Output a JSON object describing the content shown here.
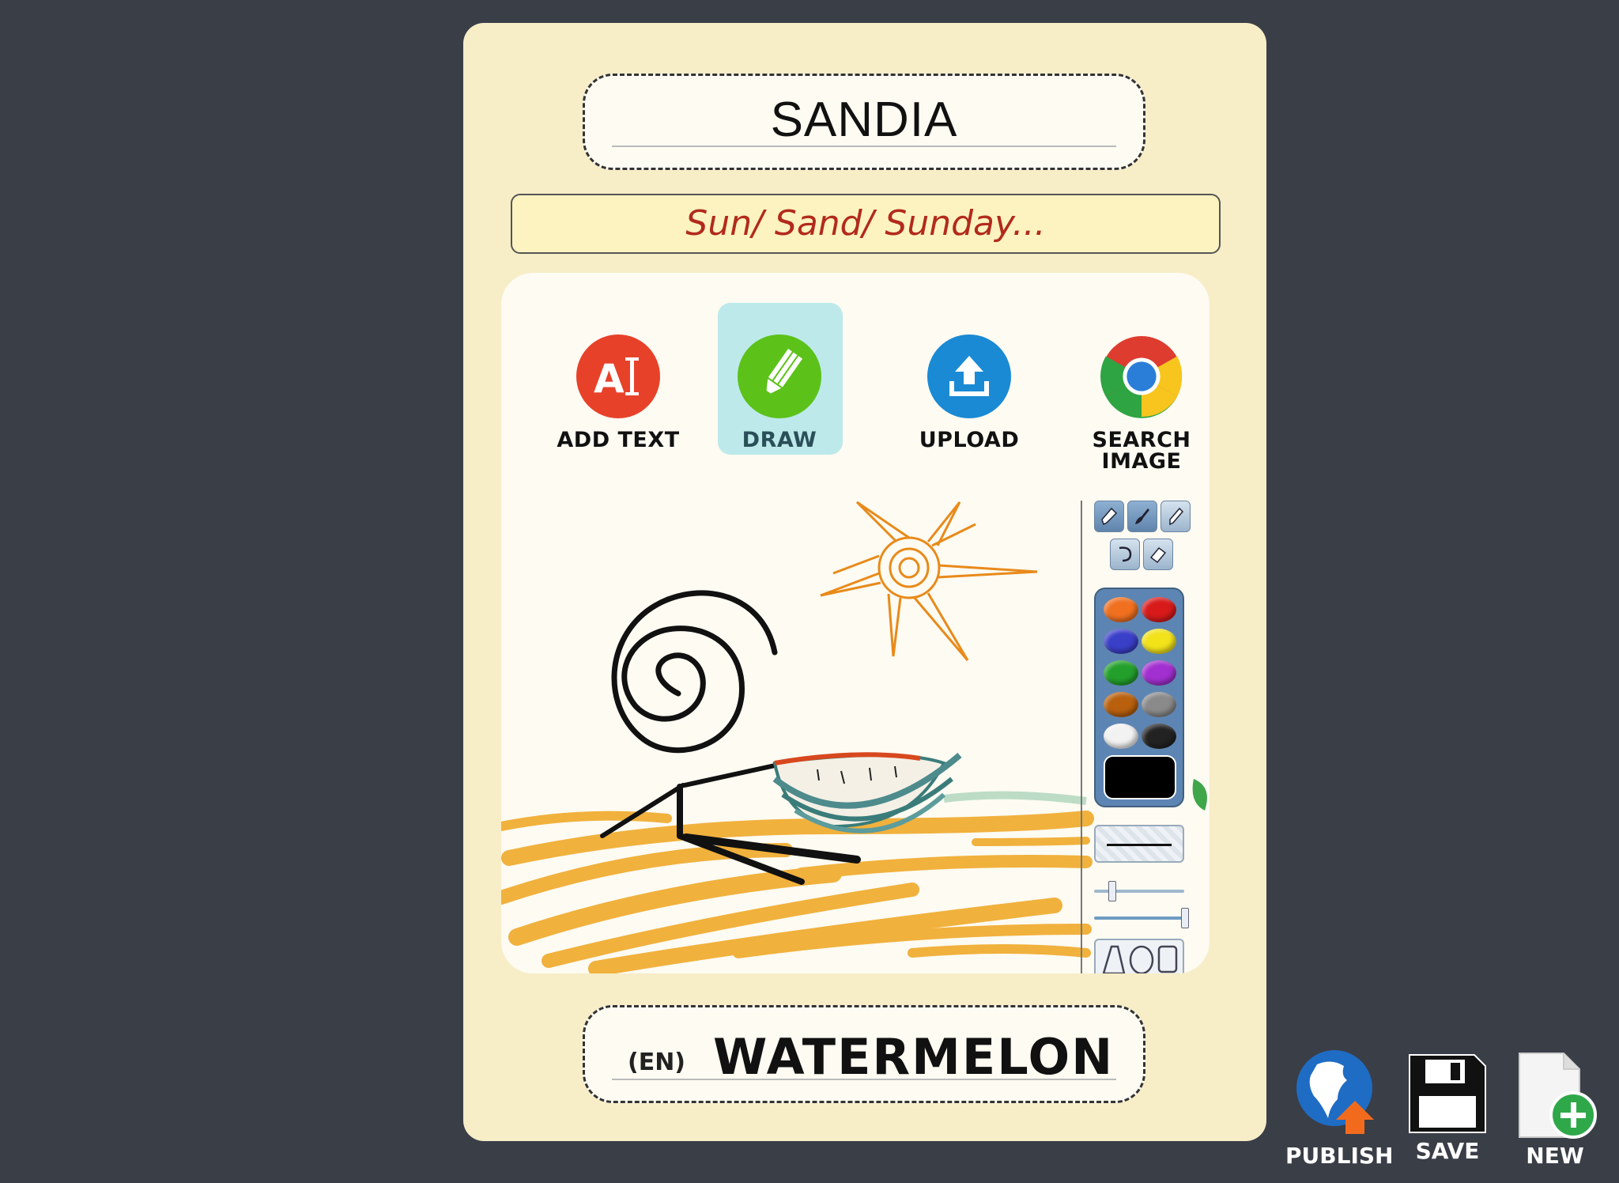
{
  "card": {
    "title": "SANDIA",
    "hint": "Sun/ Sand/ Sunday...",
    "language_tag": "(EN)",
    "translation": "WATERMELON"
  },
  "tools": [
    {
      "label": "ADD TEXT",
      "icon": "add-text-icon",
      "color": "#e8412a"
    },
    {
      "label": "DRAW",
      "icon": "pencil-icon",
      "color": "#5cc219",
      "active": true
    },
    {
      "label": "UPLOAD",
      "icon": "upload-icon",
      "color": "#1a8ad4"
    },
    {
      "label": "SEARCH",
      "label2": "IMAGE",
      "icon": "chrome-icon"
    }
  ],
  "palette": {
    "colors": [
      "#f07020",
      "#d81a1a",
      "#3a3fc8",
      "#f2e21a",
      "#23a02c",
      "#a22fd0",
      "#b8600e",
      "#8a8a8a",
      "#f2f2f2",
      "#222222"
    ],
    "current": "#000000"
  },
  "actions": [
    {
      "label": "PUBLISH",
      "icon": "globe-publish-icon"
    },
    {
      "label": "SAVE",
      "icon": "floppy-disk-icon"
    },
    {
      "label": "NEW",
      "icon": "new-document-icon"
    }
  ]
}
